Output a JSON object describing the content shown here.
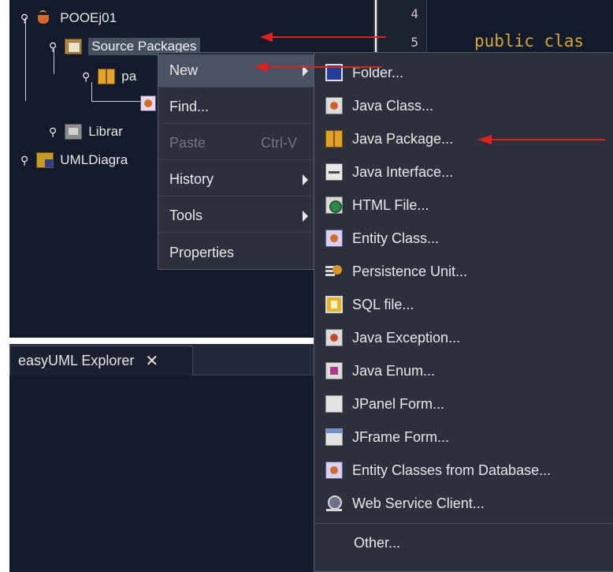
{
  "project_tree": {
    "project_name": "POOEj01",
    "source_packages": "Source Packages",
    "package_partial": "pa",
    "libraries_partial": "Librar",
    "uml_partial": "UMLDiagra"
  },
  "editor": {
    "line_numbers": [
      "4",
      "5"
    ],
    "code_line": "public clas"
  },
  "uml_explorer": {
    "tab_label": "easyUML Explorer",
    "close_glyph": "✕"
  },
  "context_menu": {
    "items": [
      {
        "label": "New",
        "highlighted": true,
        "submenu": true
      },
      {
        "label": "Find..."
      },
      {
        "label": "Paste",
        "shortcut": "Ctrl-V",
        "disabled": true
      },
      {
        "label": "History",
        "submenu": true
      },
      {
        "label": "Tools",
        "submenu": true
      },
      {
        "label": "Properties"
      }
    ]
  },
  "new_submenu": {
    "items": [
      {
        "label": "Folder...",
        "icon": "folder-icon"
      },
      {
        "label": "Java Class...",
        "icon": "java-class-icon"
      },
      {
        "label": "Java Package...",
        "icon": "java-package-icon"
      },
      {
        "label": "Java Interface...",
        "icon": "java-interface-icon"
      },
      {
        "label": "HTML File...",
        "icon": "html-file-icon"
      },
      {
        "label": "Entity Class...",
        "icon": "entity-class-icon"
      },
      {
        "label": "Persistence Unit...",
        "icon": "persistence-unit-icon"
      },
      {
        "label": "SQL file...",
        "icon": "sql-file-icon"
      },
      {
        "label": "Java Exception...",
        "icon": "java-exception-icon"
      },
      {
        "label": "Java Enum...",
        "icon": "java-enum-icon"
      },
      {
        "label": "JPanel Form...",
        "icon": "jpanel-form-icon"
      },
      {
        "label": "JFrame Form...",
        "icon": "jframe-form-icon"
      },
      {
        "label": "Entity Classes from Database...",
        "icon": "entity-classes-db-icon"
      },
      {
        "label": "Web Service Client...",
        "icon": "web-service-client-icon"
      }
    ],
    "other_label": "Other..."
  },
  "colors": {
    "annotation_arrow": "#e0201a",
    "panel_bg": "#131a2b",
    "menu_bg": "#2b303c",
    "menu_highlight": "#4a5263",
    "code_keyword": "#d4a933"
  }
}
